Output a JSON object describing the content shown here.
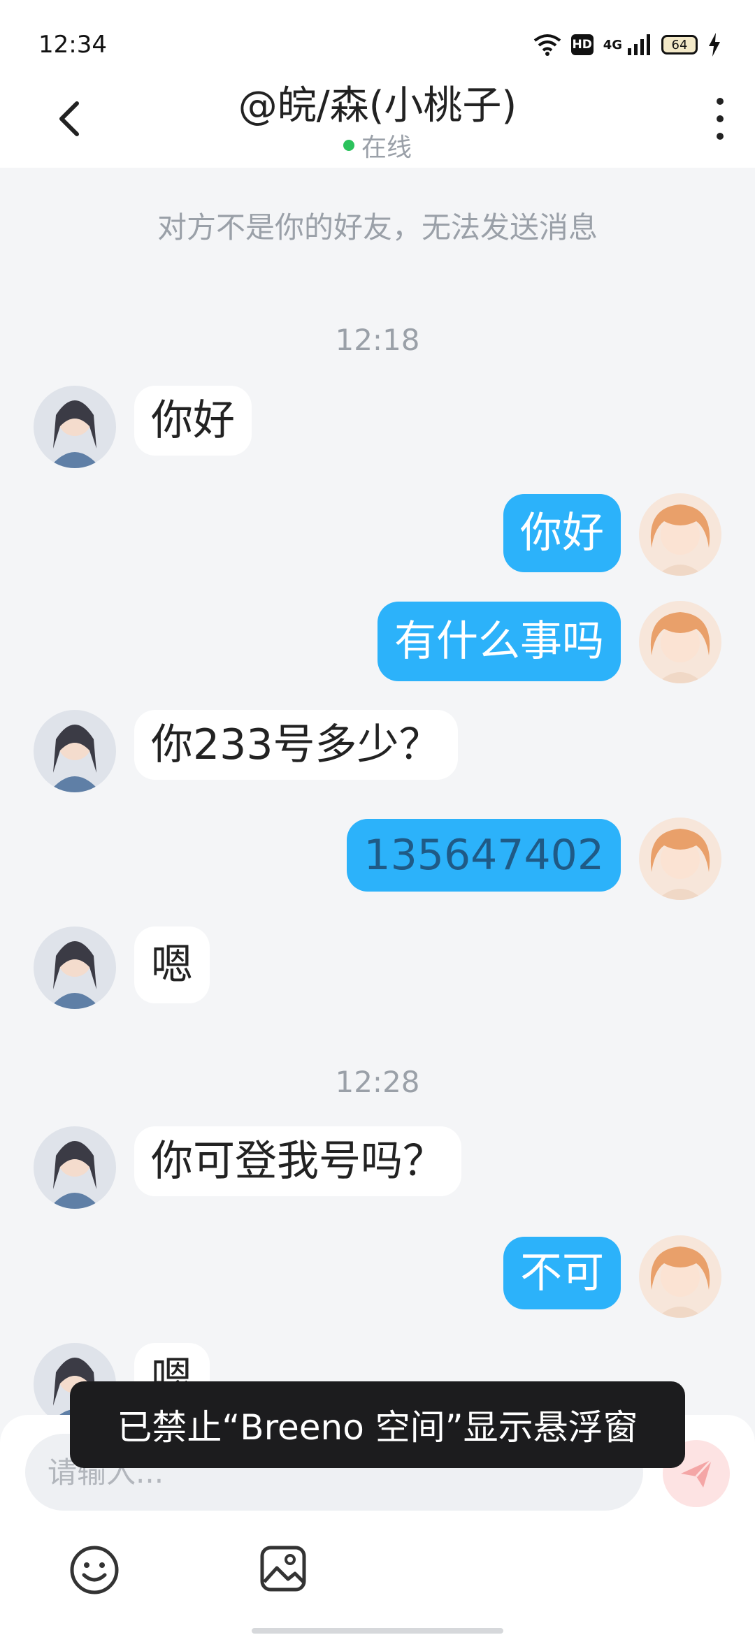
{
  "status_bar": {
    "time": "12:34",
    "hd": "HD",
    "network": "4G",
    "battery": "64"
  },
  "header": {
    "title": "@皖/森(小桃子)",
    "status": "在线",
    "status_color": "#2bc25c"
  },
  "notice": "对方不是你的好友，无法发送消息",
  "messages": [
    {
      "type": "time",
      "text": "12:18"
    },
    {
      "type": "in",
      "text": "你好"
    },
    {
      "type": "out",
      "text": "你好"
    },
    {
      "type": "out",
      "text": "有什么事吗"
    },
    {
      "type": "in",
      "text": "你233号多少？"
    },
    {
      "type": "out",
      "text": "135647402"
    },
    {
      "type": "in",
      "text": "嗯"
    },
    {
      "type": "time",
      "text": "12:28"
    },
    {
      "type": "in",
      "text": "你可登我号吗？"
    },
    {
      "type": "out",
      "text": "不可"
    },
    {
      "type": "in",
      "text": "嗯"
    }
  ],
  "input": {
    "placeholder": "请输入..."
  },
  "toast": "已禁止“Breeno 空间”显示悬浮窗",
  "colors": {
    "outgoing_bubble": "#2cb2fa",
    "incoming_bubble": "#ffffff",
    "background": "#f4f5f7"
  },
  "icons": [
    "back-arrow-icon",
    "more-vertical-icon",
    "send-icon",
    "emoji-icon",
    "image-icon"
  ]
}
